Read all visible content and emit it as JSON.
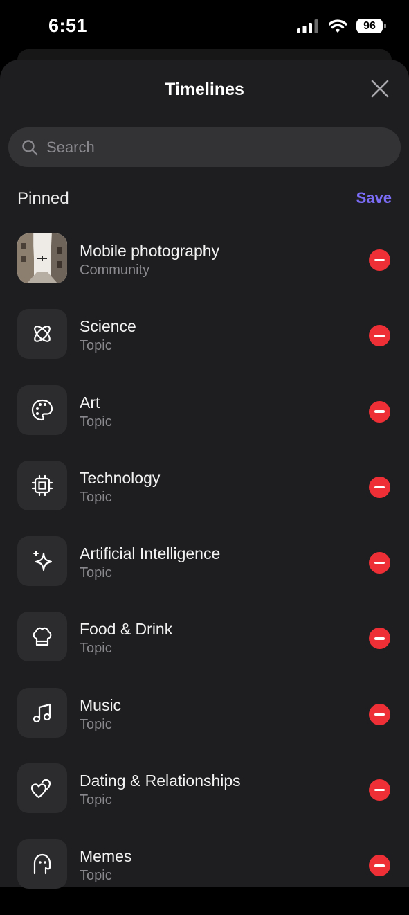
{
  "status_bar": {
    "time": "6:51",
    "battery": "96"
  },
  "sheet": {
    "title": "Timelines"
  },
  "search": {
    "placeholder": "Search",
    "value": ""
  },
  "section": {
    "title": "Pinned",
    "save_label": "Save"
  },
  "items": [
    {
      "title": "Mobile photography",
      "subtitle": "Community",
      "icon": "community-photo"
    },
    {
      "title": "Science",
      "subtitle": "Topic",
      "icon": "atom-icon"
    },
    {
      "title": "Art",
      "subtitle": "Topic",
      "icon": "palette-icon"
    },
    {
      "title": "Technology",
      "subtitle": "Topic",
      "icon": "chip-icon"
    },
    {
      "title": "Artificial Intelligence",
      "subtitle": "Topic",
      "icon": "sparkle-icon"
    },
    {
      "title": "Food & Drink",
      "subtitle": "Topic",
      "icon": "chef-hat-icon"
    },
    {
      "title": "Music",
      "subtitle": "Topic",
      "icon": "music-note-icon"
    },
    {
      "title": "Dating & Relationships",
      "subtitle": "Topic",
      "icon": "hearts-icon"
    },
    {
      "title": "Memes",
      "subtitle": "Topic",
      "icon": "meme-face-icon"
    }
  ],
  "colors": {
    "accent": "#7b6cf6",
    "remove": "#ee2f35",
    "sheet_bg": "#1e1e20"
  }
}
